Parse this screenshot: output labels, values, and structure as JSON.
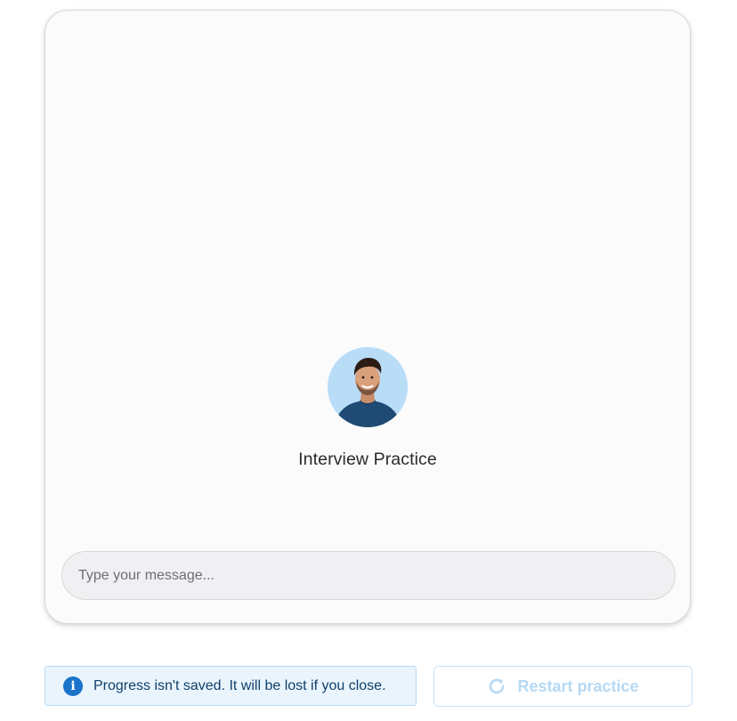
{
  "chat": {
    "persona_name": "Interview Practice",
    "avatar_alt": "Interview practice persona avatar",
    "input_placeholder": "Type your message..."
  },
  "notice": {
    "text": "Progress isn't saved. It will be lost if you close.",
    "icon": "info-icon"
  },
  "actions": {
    "restart_label": "Restart practice",
    "restart_icon": "refresh-icon",
    "restart_disabled": true
  },
  "colors": {
    "card_background": "#fbfbfc",
    "avatar_background": "#b9dcf7",
    "info_accent": "#1a73c9",
    "notice_background": "#e9f4fd",
    "disabled_button_text": "#b6d9f4"
  }
}
